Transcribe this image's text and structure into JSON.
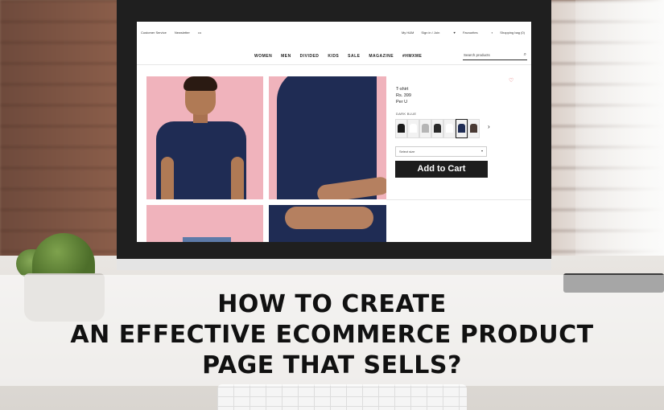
{
  "site": {
    "topbar_left": [
      "Customer Service",
      "Newsletter",
      "•••"
    ],
    "topbar_right": [
      "My H&M",
      "Sign in / Join",
      "Favourites",
      "Shopping bag (0)"
    ],
    "nav": [
      "WOMEN",
      "MEN",
      "DIVIDED",
      "KIDS",
      "SALE",
      "MAGAZINE",
      "#HMXME"
    ],
    "search_placeholder": "Search products"
  },
  "product": {
    "name": "T-shirt",
    "price": "Rs. 399",
    "unit": "Per U",
    "color_label": "DARK BLUE",
    "swatch_colors": [
      "#1a1a1a",
      "#ffffff",
      "#b5b5b5",
      "#2a2a2a",
      "#ffffff",
      "#1f2c54",
      "#4a3a34"
    ],
    "selected_swatch": 5,
    "size_placeholder": "Select size",
    "add_to_cart": "Add to Cart"
  },
  "headline": {
    "line1": "HOW TO CREATE",
    "line2": "AN EFFECTIVE ECOMMERCE PRODUCT",
    "line3": "PAGE THAT SELLS?"
  },
  "colors": {
    "image_bg": "#f0b3bc",
    "shirt": "#1f2c54",
    "button": "#1d1d1d"
  }
}
